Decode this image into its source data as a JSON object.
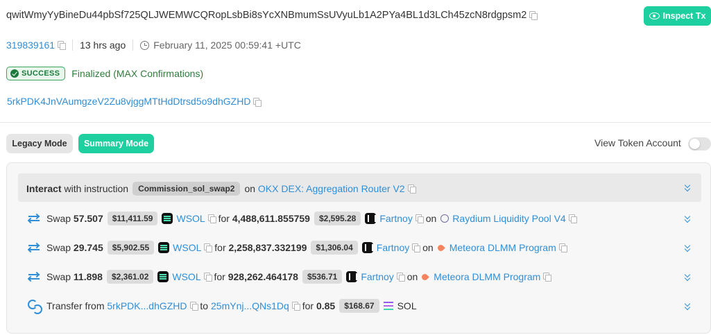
{
  "header": {
    "signature": "qwitWmyYyBineDu44pbSf725QLJWEMWCQRopLsbBi8sYcXNBmumSsUVyuLb1A2PYa4BL1d3LCh45zcN8rdgpsm2",
    "inspect_label": "Inspect Tx"
  },
  "meta": {
    "block": "319839161",
    "age": "13 hrs ago",
    "timestamp": "February 11, 2025 00:59:41 +UTC",
    "status": "SUCCESS",
    "finality": "Finalized (MAX Confirmations)",
    "signer": "5rkPDK4JnVAumgzeV2Zu8vjggMTtHdDtrsd5o9dhGZHD"
  },
  "modes": {
    "legacy_label": "Legacy Mode",
    "summary_label": "Summary Mode",
    "view_token_account_label": "View Token Account",
    "view_token_account_enabled": false
  },
  "instruction": {
    "interact": "Interact",
    "with_text": "with instruction",
    "name": "Commission_sol_swap2",
    "on": "on",
    "program": "OKX DEX: Aggregation Router V2"
  },
  "swaps": [
    {
      "verb": "Swap",
      "amount_in": "57.507",
      "usd_in": "$11,411.59",
      "token_in": "WSOL",
      "for": "for",
      "amount_out": "4,488,611.855759",
      "usd_out": "$2,595.28",
      "token_out": "Fartnoy",
      "on": "on",
      "pool": "Raydium Liquidity Pool V4"
    },
    {
      "verb": "Swap",
      "amount_in": "29.745",
      "usd_in": "$5,902.55",
      "token_in": "WSOL",
      "for": "for",
      "amount_out": "2,258,837.332199",
      "usd_out": "$1,306.04",
      "token_out": "Fartnoy",
      "on": "on",
      "pool": "Meteora DLMM Program"
    },
    {
      "verb": "Swap",
      "amount_in": "11.898",
      "usd_in": "$2,361.02",
      "token_in": "WSOL",
      "for": "for",
      "amount_out": "928,262.464178",
      "usd_out": "$536.71",
      "token_out": "Fartnoy",
      "on": "on",
      "pool": "Meteora DLMM Program"
    }
  ],
  "transfer": {
    "verb": "Transfer from",
    "from": "5rkPDK...dhGZHD",
    "to_word": "to",
    "to": "25mYnj...QNs1Dq",
    "for": "for",
    "amount": "0.85",
    "usd": "$168.67",
    "token": "SOL"
  },
  "colors": {
    "accent": "#1ecfa0",
    "link": "#2f8ed8",
    "success": "#2e7d3b"
  }
}
